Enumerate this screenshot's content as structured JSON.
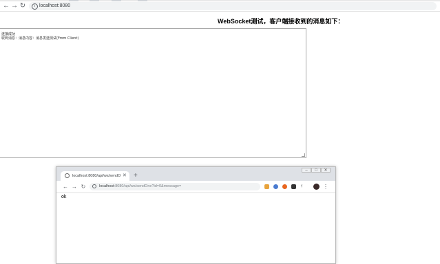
{
  "browser": {
    "url": "localhost:8080",
    "icons": {
      "back": "back-arrow-icon",
      "forward": "forward-arrow-icon",
      "reload": "reload-icon",
      "info": "info-icon"
    }
  },
  "page": {
    "title": "WebSocket测试，客户端接收到的消息如下：",
    "messages": [
      "连接成功",
      "收到消息：消息内容：消息发送测试(From Client)"
    ]
  },
  "second_window": {
    "tab_title": "localhost:8080/api/ws/sendO",
    "url_host": "localhost",
    "url_rest": ":8080/api/ws/sendOne?id=0&message=",
    "content": "ok",
    "icons": [
      "tab-close-icon",
      "new-tab-icon",
      "extension-icon",
      "profile-icon",
      "menu-icon"
    ]
  }
}
